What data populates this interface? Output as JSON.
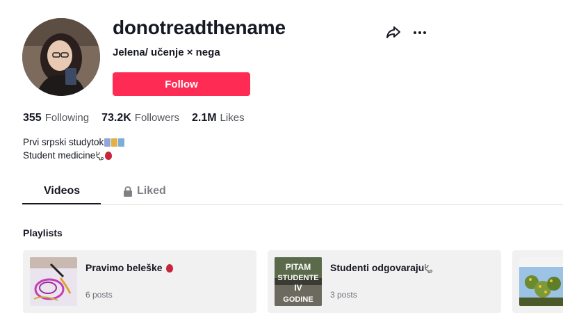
{
  "profile": {
    "username": "donotreadthename",
    "nickname": "Jelena/ učenje × nega",
    "follow_label": "Follow"
  },
  "stats": {
    "following_count": "355",
    "following_label": "Following",
    "followers_count": "73.2K",
    "followers_label": "Followers",
    "likes_count": "2.1M",
    "likes_label": "Likes"
  },
  "bio": {
    "line1": "Prvi srpski studytok",
    "line2": "Student medicine"
  },
  "tabs": {
    "videos": "Videos",
    "liked": "Liked"
  },
  "playlists": {
    "title": "Playlists",
    "items": [
      {
        "title": "Pravimo beleške",
        "count": "6 posts"
      },
      {
        "title": "Studenti odgovaraju",
        "count": "3 posts"
      },
      {
        "title": "",
        "count": ""
      }
    ]
  },
  "thumbnail_text": {
    "studenti": [
      "PITAM",
      "STUDENTE",
      "IV",
      "GODINE"
    ]
  },
  "colors": {
    "accent": "#fe2c55",
    "text": "#161823"
  }
}
